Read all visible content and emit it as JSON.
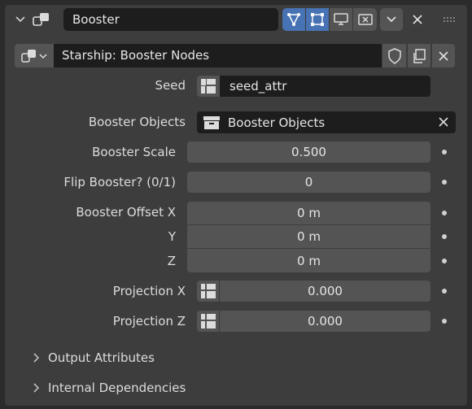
{
  "header": {
    "panel_name": "Booster",
    "colors": {
      "accent": "#4772b3",
      "field_dark": "#1d1d1d",
      "field": "#545454",
      "panel": "#3d3d3d"
    }
  },
  "node_group": {
    "name": "Starship: Booster Nodes"
  },
  "seed": {
    "label": "Seed",
    "value": "seed_attr"
  },
  "booster_objects": {
    "label": "Booster Objects",
    "value": "Booster Objects"
  },
  "booster_scale": {
    "label": "Booster Scale",
    "value": "0.500"
  },
  "flip_booster": {
    "label": "Flip Booster? (0/1)",
    "value": "0"
  },
  "booster_offset": {
    "label_x": "Booster Offset X",
    "value_x": "0 m",
    "label_y": "Y",
    "value_y": "0 m",
    "label_z": "Z",
    "value_z": "0 m"
  },
  "projection_x": {
    "label": "Projection X",
    "value": "0.000"
  },
  "projection_z": {
    "label": "Projection Z",
    "value": "0.000"
  },
  "subpanels": [
    {
      "label": "Output Attributes"
    },
    {
      "label": "Internal Dependencies"
    }
  ]
}
